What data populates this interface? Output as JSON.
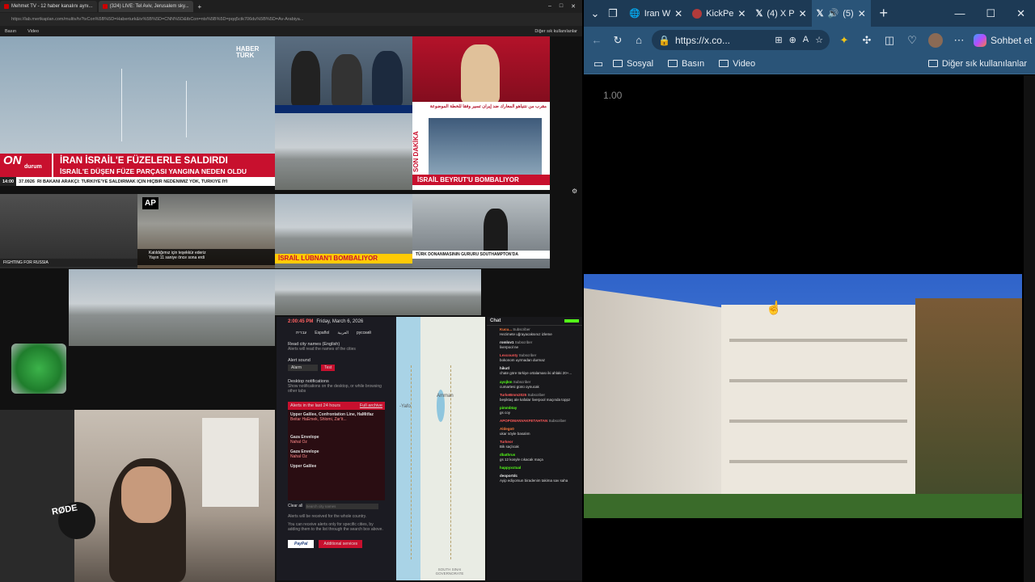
{
  "left_window": {
    "tabs": [
      {
        "label": "Mehmet TV - 12 haber kanalını aynı..."
      },
      {
        "label": "(324) LIVE: Tel Aviv, Jerusalem sky..."
      }
    ],
    "address": "https://lab.mertkaplan.com/multiv/tv?tvCon%5B%5D=Haberturk&tv%5B%5D=CNN%5D&tbCon=nts%5B%5D=pqq5ctk706du%5B%5D=Av-Arabiya...",
    "bookmarks": [
      "Basın",
      "Video"
    ],
    "other_bookmarks": "Diğer sık kullanılanlar",
    "tiles": {
      "haberturk_logo": "HABER TÜRK",
      "on_label": "ON",
      "durum_label": "durum",
      "headline_1": "İRAN İSRAİL'E FÜZELERLE SALDIRDI",
      "headline_2": "İSRAİL'E DÜŞEN FÜZE PARÇASI YANGINA NEDEN OLDU",
      "ticker_1": "RI BAKANI ARAKÇI: TÜRKİYE'YE SALDIRMAK İÇİN HİÇBİR NEDENİMİZ YOK, TÜRKİYE İYİ",
      "ticker_time": "14:00",
      "ticker_value": "37.0926",
      "arabic_caption": "مقرب من نتنياهو المعارك ضد إيران تسير وفقا للخطة الموضوعة",
      "sondakika_label": "SON DAKİKA",
      "beyrut_headline": "İSRAİL BEYRUT'U BOMBALIYOR",
      "ap_label": "AP",
      "fighting_label": "FIGHTING FOR RUSSIA",
      "katildigimiz": "Katıldığımız için teşekkür ederiz",
      "katildigimiz_2": "Yayın 11 saniye önce sona erdi",
      "lubnan_headline": "İSRAİL LÜBNAN'I BOMBALIYOR",
      "turk_donanma": "TÜRK DONANMASININ GURURU SOUTHAMPTON'DA"
    },
    "oref": {
      "time": "2:00:45 PM",
      "date": "Friday, March 6, 2026",
      "langs": [
        "עברית",
        "Español",
        "العربية",
        "русский"
      ],
      "read_city_title": "Read city names (English)",
      "read_city_sub": "Alerts will read the names of the cities",
      "alert_sound_title": "Alert sound",
      "alarm_select": "Alarm",
      "test_button": "Test",
      "desktop_title": "Desktop notifications",
      "desktop_sub": "Show notifications on the desktop, or while browsing other tabs",
      "alerts_header": "Alerts in the last 24 hours",
      "full_archive": "Full archive",
      "alert_items": [
        {
          "region": "Upper Galilee, Confrontation Line, HaMitfaz",
          "detail": "Beitar HaEmek, Shlomi, Zar'it..."
        },
        {
          "region": "Gaza Envelope",
          "detail": "Nahal Oz"
        },
        {
          "region": "Gaza Envelope",
          "detail": "Nahal Oz"
        },
        {
          "region": "Upper Galilee",
          "detail": ""
        }
      ],
      "clear_all": "Clear all",
      "search_placeholder": "Search city names",
      "whole_country": "Alerts will be received for the whole country.",
      "receive_note": "You can receive alerts only for specific cities, by adding them to the list through the search box above.",
      "paypal_label": "PayPal",
      "additional_services": "Additional services"
    },
    "map_labels": {
      "amman": "Amman",
      "yafo": "-Yafo",
      "governorate": "SOUTH SINAI GOVERNORATE"
    },
    "chat": {
      "title": "Chat",
      "messages": [
        {
          "user": "Kucu...",
          "badge": "Subscriber",
          "text": "Hezimete uğrayacaksınız izleme"
        },
        {
          "user": "romlov1",
          "badge": "Subscriber",
          "text": "liverpool ne"
        },
        {
          "user": "Lexcounty",
          "badge": "Subscriber",
          "text": "bokonom uyrmadan durmaz"
        },
        {
          "user": "hikutl",
          "badge": "",
          "text": "chate göre türkiye ortalaması iki ahlaki 20+..."
        },
        {
          "user": "ayojkm",
          "badge": "Subscriber",
          "text": "cumartesi günü oynucak"
        },
        {
          "user": "TurkeBmm2025",
          "badge": "Subscriber",
          "text": "beşiktaş ale kafalar liverpool maçında toppz"
        },
        {
          "user": "pimmbtay",
          "badge": "",
          "text": "gs coy"
        },
        {
          "user": "APOPOMANVAKFETAHTAN",
          "badge": "Subscriber",
          "text": ""
        },
        {
          "user": "Aldego0",
          "badge": "",
          "text": "ukar söyle basalım"
        },
        {
          "user": "Turkeor",
          "badge": "",
          "text": "Bik saçlıcak"
        },
        {
          "user": "dbathrus",
          "badge": "",
          "text": "gs 12 kosyle cıkacak maça"
        },
        {
          "user": "happyxctual",
          "badge": "",
          "text": ""
        },
        {
          "user": "deoportdc",
          "badge": "",
          "text": "Ayip ediyorsun biradenim takima sav saha"
        }
      ]
    },
    "webcam_brand": "RØDE"
  },
  "right_window": {
    "tabs": [
      {
        "label": "Iran W",
        "icon": "globe-icon"
      },
      {
        "label": "KickPe",
        "icon": "kick-icon"
      },
      {
        "label": "(4) X P",
        "icon": "x-icon"
      },
      {
        "label": "(5)",
        "icon": "x-icon",
        "audio": true
      }
    ],
    "url": "https://x.co...",
    "chat_button": "Sohbet et",
    "bookmarks": [
      "Sosyal",
      "Basın",
      "Video"
    ],
    "other_bookmarks": "Diğer sık kullanılanlar",
    "playback_speed": "1.00"
  },
  "colors": {
    "edge_blue": "#2a5478",
    "edge_dark_blue": "#1d3a55",
    "news_red": "#c8102e",
    "kick_green": "#53fc18"
  }
}
